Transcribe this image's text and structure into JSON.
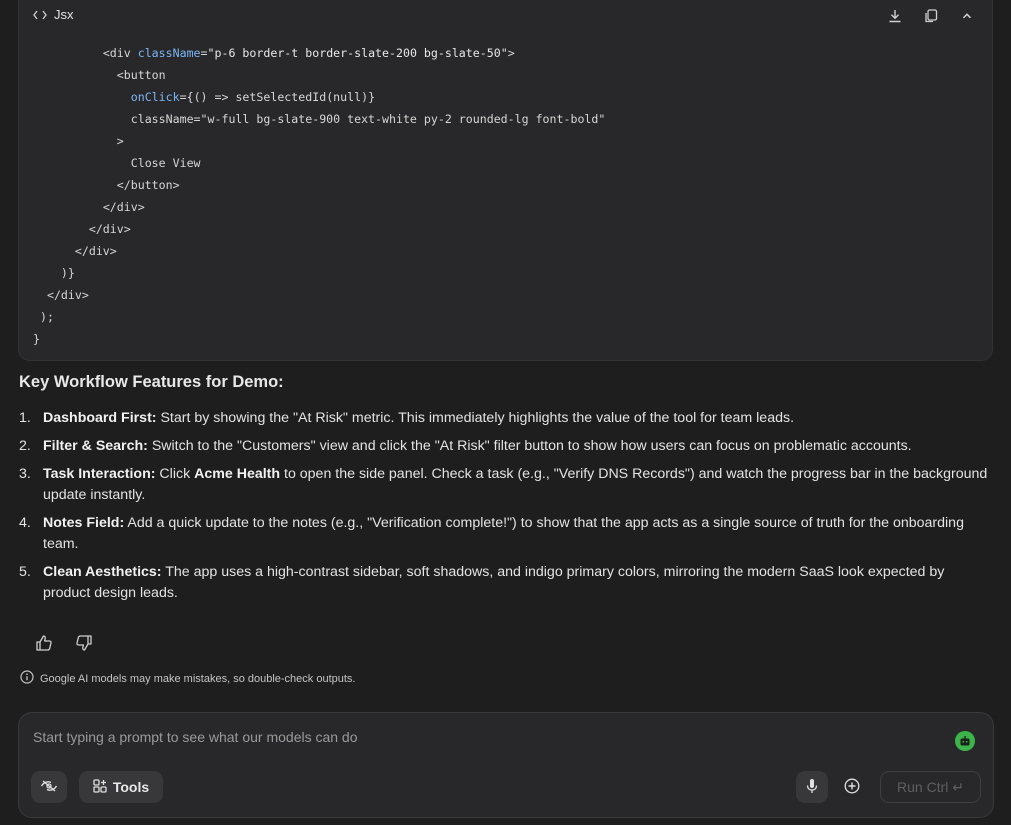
{
  "code_block": {
    "language": "Jsx",
    "lines": [
      {
        "indent": "          ",
        "parts": [
          [
            "tag",
            "<div "
          ],
          [
            "attr",
            "className"
          ],
          [
            "tag",
            "="
          ],
          [
            "str",
            "\"p-6 border-t border-slate-200 bg-slate-50\""
          ],
          [
            "tag",
            ">"
          ]
        ]
      },
      {
        "indent": "            ",
        "parts": [
          [
            "tag",
            "<button"
          ]
        ]
      },
      {
        "indent": "              ",
        "parts": [
          [
            "attr",
            "onClick"
          ],
          [
            "tag",
            "={() => setSelectedId(null)}"
          ]
        ]
      },
      {
        "indent": "              ",
        "parts": [
          [
            "tag",
            "className=\"w-full bg-slate-900 text-white py-2 rounded-lg font-bold\""
          ]
        ]
      },
      {
        "indent": "            ",
        "parts": [
          [
            "tag",
            ">"
          ]
        ]
      },
      {
        "indent": "              ",
        "parts": [
          [
            "tag",
            "Close View"
          ]
        ]
      },
      {
        "indent": "            ",
        "parts": [
          [
            "tag",
            "</button>"
          ]
        ]
      },
      {
        "indent": "          ",
        "parts": [
          [
            "tag",
            "</div>"
          ]
        ]
      },
      {
        "indent": "        ",
        "parts": [
          [
            "tag",
            "</div>"
          ]
        ]
      },
      {
        "indent": "      ",
        "parts": [
          [
            "tag",
            "</div>"
          ]
        ]
      },
      {
        "indent": "    ",
        "parts": [
          [
            "tag",
            ")}"
          ]
        ]
      },
      {
        "indent": "  ",
        "parts": [
          [
            "tag",
            "</div>"
          ]
        ]
      },
      {
        "indent": " ",
        "parts": [
          [
            "tag",
            ");"
          ]
        ]
      },
      {
        "indent": "",
        "parts": [
          [
            "tag",
            "}"
          ]
        ]
      }
    ]
  },
  "article": {
    "heading": "Key Workflow Features for Demo:",
    "features": [
      {
        "num": "1.",
        "title": "Dashboard First:",
        "text": " Start by showing the \"At Risk\" metric. This immediately highlights the value of the tool for team leads."
      },
      {
        "num": "2.",
        "title": "Filter & Search:",
        "text": " Switch to the \"Customers\" view and click the \"At Risk\" filter button to show how users can focus on problematic accounts."
      },
      {
        "num": "3.",
        "title": "Task Interaction:",
        "text_before": " Click ",
        "bold_inline": "Acme Health",
        "text": " to open the side panel. Check a task (e.g., \"Verify DNS Records\") and watch the progress bar in the background update instantly."
      },
      {
        "num": "4.",
        "title": "Notes Field:",
        "text": " Add a quick update to the notes (e.g., \"Verification complete!\") to show that the app acts as a single source of truth for the onboarding team."
      },
      {
        "num": "5.",
        "title": "Clean Aesthetics:",
        "text": " The app uses a high-contrast sidebar, soft shadows, and indigo primary colors, mirroring the modern SaaS look expected by product design leads."
      }
    ]
  },
  "disclaimer": "Google AI models may make mistakes, so double-check outputs.",
  "prompt": {
    "placeholder": "Start typing a prompt to see what our models can do",
    "tools_label": "Tools",
    "run_label": "Run Ctrl ↵"
  },
  "icons": {
    "code": "code-icon",
    "download": "download-icon",
    "copy": "copy-icon",
    "collapse": "chevron-up-icon",
    "thumbs_up": "thumbs-up-icon",
    "thumbs_down": "thumbs-down-icon",
    "info": "info-icon",
    "bot": "bot-icon",
    "toggle": "toggle-icon",
    "tools": "tools-icon",
    "mic": "mic-icon",
    "add": "add-circle-icon"
  },
  "colors": {
    "background": "#1e1e1f",
    "card": "#28282a",
    "attr": "#7ab6f5",
    "bot_green": "#3bb54a"
  }
}
